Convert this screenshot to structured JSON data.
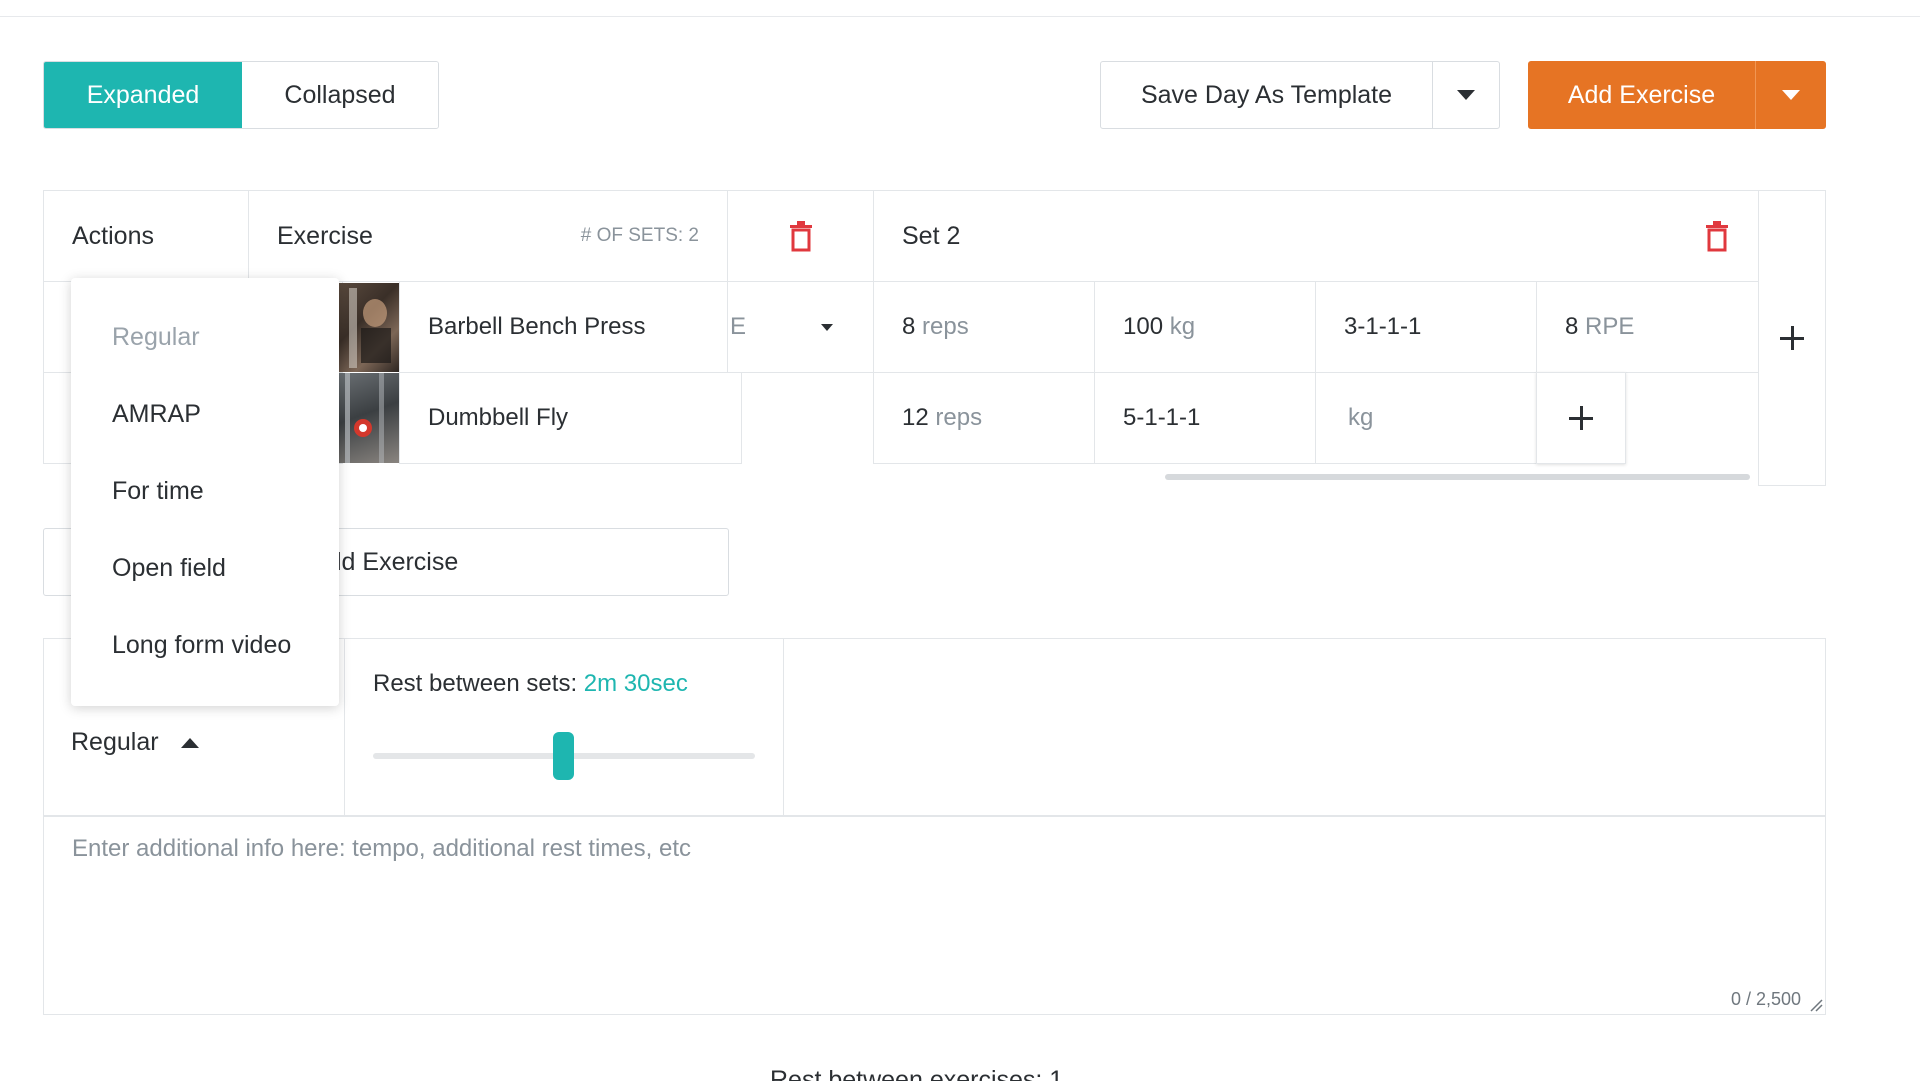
{
  "view_toggle": {
    "expanded_label": "Expanded",
    "collapsed_label": "Collapsed"
  },
  "toolbar": {
    "save_template_label": "Save Day As Template",
    "add_exercise_label": "Add Exercise"
  },
  "table": {
    "headers": {
      "actions": "Actions",
      "exercise": "Exercise",
      "sets_count": "# OF SETS: 2",
      "set_label": "Set 2"
    },
    "rows": [
      {
        "name": "Barbell Bench Press",
        "type_partial": "E",
        "cells": [
          {
            "value": "8",
            "unit": "reps"
          },
          {
            "value": "100",
            "unit": "kg"
          },
          {
            "value": "3-1-1-1",
            "unit": ""
          },
          {
            "value": "8",
            "unit": "RPE"
          }
        ]
      },
      {
        "name": "Dumbbell Fly",
        "cells": [
          {
            "value": "12",
            "unit": "reps"
          },
          {
            "value": "5-1-1-1",
            "unit": ""
          },
          {
            "value": "",
            "unit": "kg"
          }
        ]
      }
    ]
  },
  "add_exercise_row": {
    "label_partial": "ld Exercise"
  },
  "set_type_dropdown": {
    "options": [
      "Regular",
      "AMRAP",
      "For time",
      "Open field",
      "Long form video"
    ],
    "selected": "Regular"
  },
  "rest": {
    "label": "Rest between sets:",
    "value": "2m 30sec",
    "slider_fraction": 0.47
  },
  "notes": {
    "placeholder": "Enter additional info here: tempo, additional rest times, etc",
    "counter": "0 / 2,500"
  },
  "bottom_partial_text": "Rest between exercises: 1...",
  "colors": {
    "teal": "#1eb6b0",
    "orange": "#e67424",
    "red": "#e0383e"
  }
}
